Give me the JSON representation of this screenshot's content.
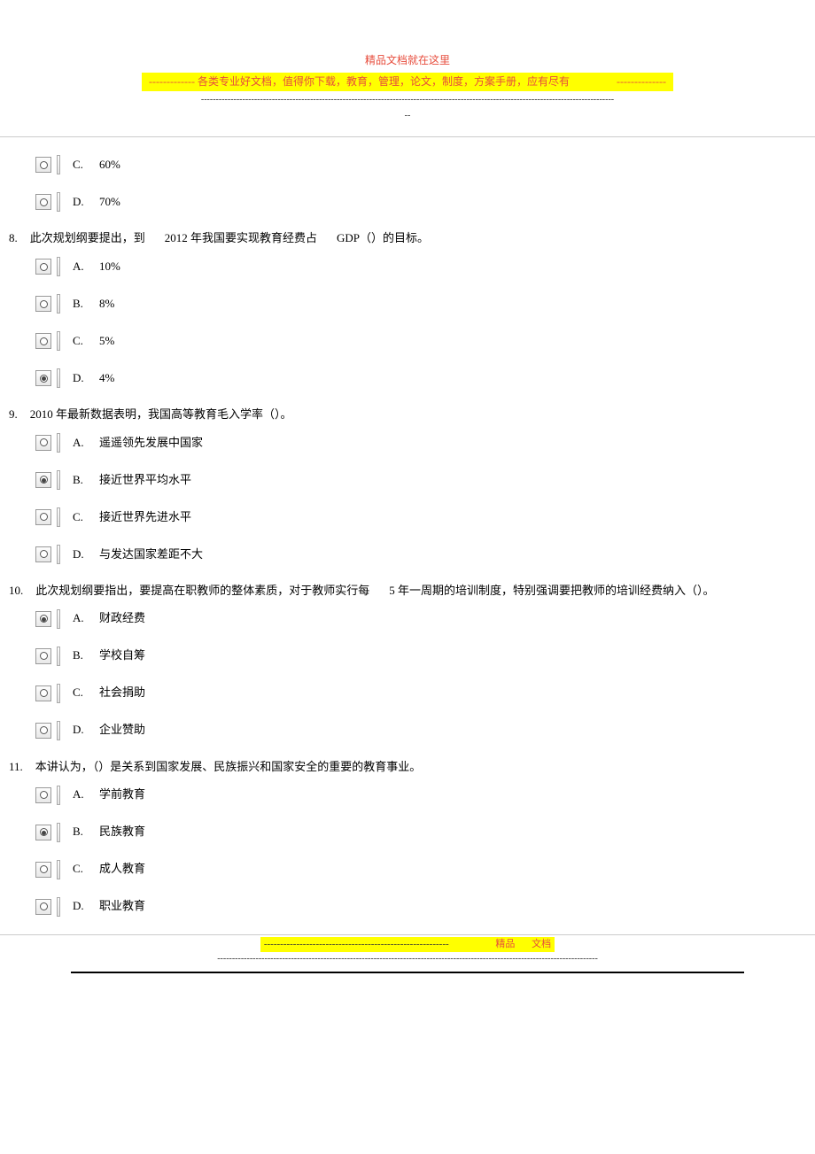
{
  "header": {
    "title": "精品文档就在这里",
    "subtitle_prefix": "-------------",
    "subtitle": "各类专业好文档，值得你下载，教育，管理，论文，制度，方案手册，应有尽有",
    "subtitle_suffix": "--------------",
    "dashes1": "--------------------------------------------------------------------------------------------------------------------------------------------",
    "dashes2": "--"
  },
  "prev_options": [
    {
      "letter": "C.",
      "text": "60%",
      "selected": false
    },
    {
      "letter": "D.",
      "text": "70%",
      "selected": false
    }
  ],
  "questions": [
    {
      "num": "8.",
      "stem_parts": [
        "此次规划纲要提出，到",
        "2012 年我国要实现教育经费占",
        "GDP（）的目标。"
      ],
      "options": [
        {
          "letter": "A.",
          "text": "10%",
          "selected": false
        },
        {
          "letter": "B.",
          "text": "8%",
          "selected": false
        },
        {
          "letter": "C.",
          "text": "5%",
          "selected": false
        },
        {
          "letter": "D.",
          "text": "4%",
          "selected": true
        }
      ]
    },
    {
      "num": "9.",
      "stem_parts": [
        "2010 年最新数据表明，我国高等教育毛入学率（）。"
      ],
      "options": [
        {
          "letter": "A.",
          "text": "遥遥领先发展中国家",
          "selected": false
        },
        {
          "letter": "B.",
          "text": "接近世界平均水平",
          "selected": true
        },
        {
          "letter": "C.",
          "text": "接近世界先进水平",
          "selected": false
        },
        {
          "letter": "D.",
          "text": "与发达国家差距不大",
          "selected": false
        }
      ]
    },
    {
      "num": "10.",
      "stem_parts": [
        "此次规划纲要指出，要提高在职教师的整体素质，对于教师实行每",
        "5 年一周期的培训制度，特别强调要把教师的培训经费纳入（）。"
      ],
      "options": [
        {
          "letter": "A.",
          "text": "财政经费",
          "selected": true
        },
        {
          "letter": "B.",
          "text": "学校自筹",
          "selected": false
        },
        {
          "letter": "C.",
          "text": "社会捐助",
          "selected": false
        },
        {
          "letter": "D.",
          "text": "企业赞助",
          "selected": false
        }
      ]
    },
    {
      "num": "11.",
      "stem_parts": [
        "本讲认为，（）是关系到国家发展、民族振兴和国家安全的重要的教育事业。"
      ],
      "options": [
        {
          "letter": "A.",
          "text": "学前教育",
          "selected": false
        },
        {
          "letter": "B.",
          "text": "民族教育",
          "selected": true
        },
        {
          "letter": "C.",
          "text": "成人教育",
          "selected": false
        },
        {
          "letter": "D.",
          "text": "职业教育",
          "selected": false
        }
      ]
    }
  ],
  "footer": {
    "dashes_left": "---------------------------------------------------------",
    "label1": "精品",
    "label2": "文档",
    "dashes_bottom": "---------------------------------------------------------------------------------------------------------------------------------"
  }
}
